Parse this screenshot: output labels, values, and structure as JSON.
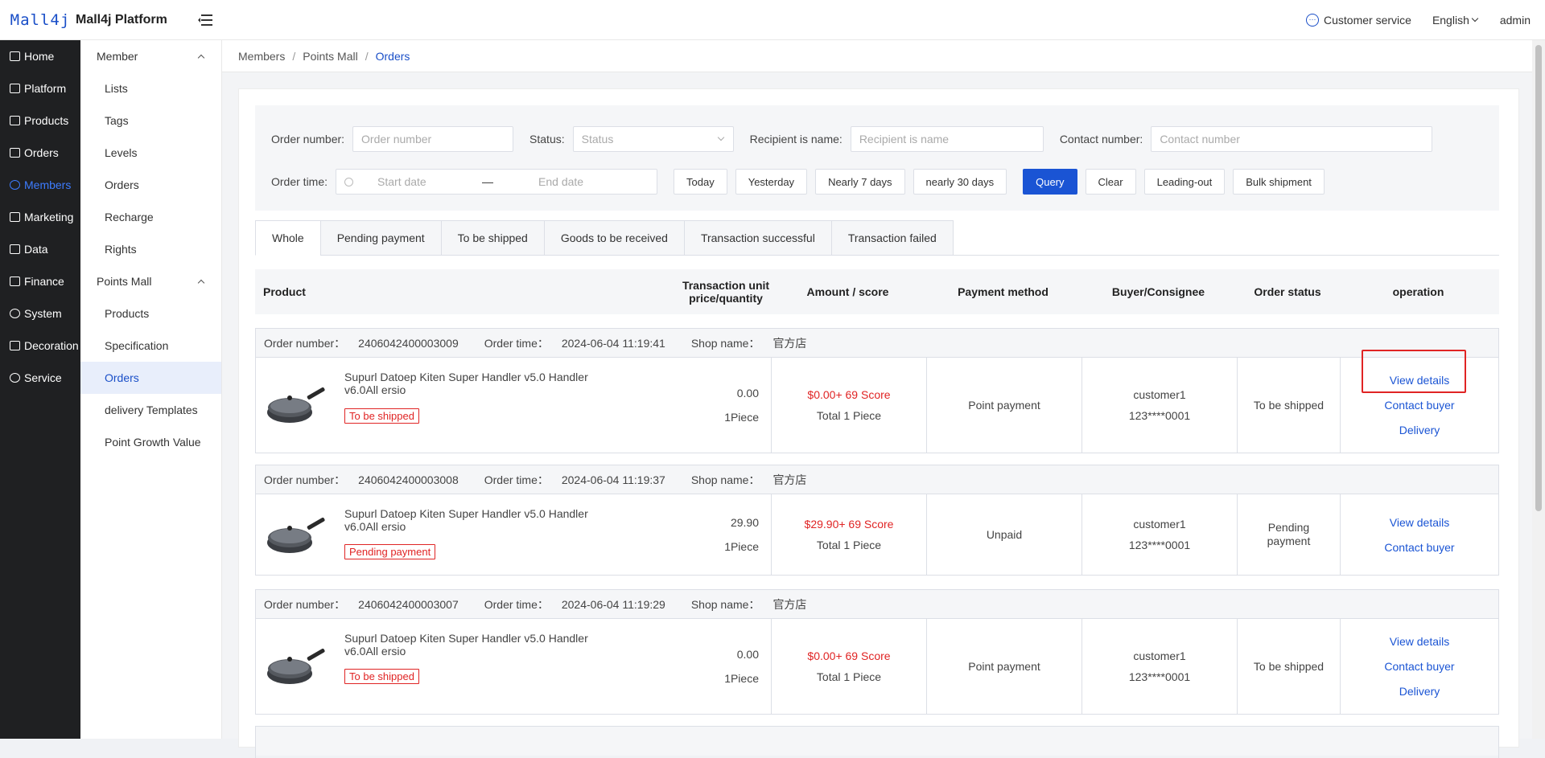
{
  "app": {
    "logo": "Mall4j",
    "name": "Mall4j Platform"
  },
  "topbar": {
    "customer_service": "Customer service",
    "language": "English",
    "user": "admin"
  },
  "nav1": [
    {
      "label": "Home",
      "icon": "home-icon"
    },
    {
      "label": "Platform",
      "icon": "platform-icon"
    },
    {
      "label": "Products",
      "icon": "products-icon"
    },
    {
      "label": "Orders",
      "icon": "orders-icon"
    },
    {
      "label": "Members",
      "icon": "members-icon"
    },
    {
      "label": "Marketing",
      "icon": "marketing-icon"
    },
    {
      "label": "Data",
      "icon": "data-icon"
    },
    {
      "label": "Finance",
      "icon": "finance-icon"
    },
    {
      "label": "System",
      "icon": "system-icon"
    },
    {
      "label": "Decoration",
      "icon": "decoration-icon"
    },
    {
      "label": "Service",
      "icon": "service-icon"
    }
  ],
  "nav2": {
    "group1": "Member",
    "group1_items": [
      "Lists",
      "Tags",
      "Levels",
      "Orders",
      "Recharge",
      "Rights"
    ],
    "group2": "Points Mall",
    "group2_items": [
      "Products",
      "Specification",
      "Orders",
      "delivery Templates",
      "Point Growth Value"
    ]
  },
  "breadcrumb": [
    "Members",
    "Points Mall",
    "Orders"
  ],
  "filters": {
    "order_number_label": "Order number:",
    "order_number_placeholder": "Order number",
    "status_label": "Status:",
    "status_placeholder": "Status",
    "recipient_label": "Recipient is name:",
    "recipient_placeholder": "Recipient is name",
    "contact_label": "Contact number:",
    "contact_placeholder": "Contact number",
    "order_time_label": "Order time:",
    "start_date": "Start date",
    "date_sep": "—",
    "end_date": "End date",
    "buttons": [
      "Today",
      "Yesterday",
      "Nearly 7 days",
      "nearly 30 days"
    ],
    "query": "Query",
    "clear": "Clear",
    "leading_out": "Leading-out",
    "bulk_shipment": "Bulk shipment"
  },
  "tabs": [
    "Whole",
    "Pending payment",
    "To be shipped",
    "Goods to be received",
    "Transaction successful",
    "Transaction failed"
  ],
  "table_headers": {
    "product": "Product",
    "unit_price": "Transaction unit price/quantity",
    "amount": "Amount / score",
    "payment": "Payment method",
    "buyer": "Buyer/Consignee",
    "status": "Order status",
    "operation": "operation"
  },
  "orders": [
    {
      "order_number_label": "Order number：",
      "order_number": "2406042400003009",
      "order_time_label": "Order time：",
      "order_time": "2024-06-04 11:19:41",
      "shop_label": "Shop name：",
      "shop": "官方店",
      "product": "Supurl Datoep Kiten Super Handler v5.0 Handler v6.0All ersio",
      "tag": "To be shipped",
      "price": "0.00",
      "qty": "1Piece",
      "amount": "$0.00+ 69 Score",
      "total": "Total 1 Piece",
      "payment": "Point payment",
      "buyer": "customer1",
      "phone": "123****0001",
      "status": "To be shipped",
      "ops": [
        "View details",
        "Contact buyer",
        "Delivery"
      ]
    },
    {
      "order_number_label": "Order number：",
      "order_number": "2406042400003008",
      "order_time_label": "Order time：",
      "order_time": "2024-06-04 11:19:37",
      "shop_label": "Shop name：",
      "shop": "官方店",
      "product": "Supurl Datoep Kiten Super Handler v5.0 Handler v6.0All ersio",
      "tag": "Pending payment",
      "price": "29.90",
      "qty": "1Piece",
      "amount": "$29.90+ 69 Score",
      "total": "Total 1 Piece",
      "payment": "Unpaid",
      "buyer": "customer1",
      "phone": "123****0001",
      "status": "Pending payment",
      "ops": [
        "View details",
        "Contact buyer"
      ]
    },
    {
      "order_number_label": "Order number：",
      "order_number": "2406042400003007",
      "order_time_label": "Order time：",
      "order_time": "2024-06-04 11:19:29",
      "shop_label": "Shop name：",
      "shop": "官方店",
      "product": "Supurl Datoep Kiten Super Handler v5.0 Handler v6.0All ersio",
      "tag": "To be shipped",
      "price": "0.00",
      "qty": "1Piece",
      "amount": "$0.00+ 69 Score",
      "total": "Total 1 Piece",
      "payment": "Point payment",
      "buyer": "customer1",
      "phone": "123****0001",
      "status": "To be shipped",
      "ops": [
        "View details",
        "Contact buyer",
        "Delivery"
      ]
    }
  ],
  "colors": {
    "accent": "#1a54d4",
    "danger": "#e02424",
    "sidebar": "#1f2022"
  }
}
